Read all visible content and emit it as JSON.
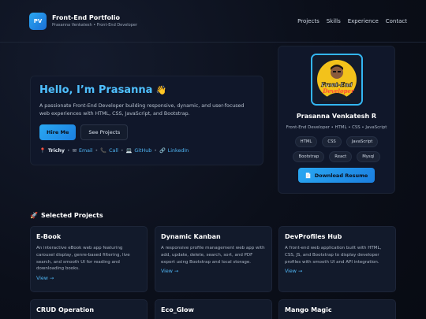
{
  "header": {
    "logo": "PV",
    "title": "Front-End Portfolio",
    "subtitle": "Prasanna Venkatesh • Front-End Developer",
    "nav": [
      "Projects",
      "Skills",
      "Experience",
      "Contact"
    ]
  },
  "hero": {
    "greeting": "Hello, I’m Prasanna",
    "wave": "👋",
    "description": "A passionate Front-End Developer building responsive, dynamic, and user-focused web experiences with HTML, CSS, JavaScript, and Bootstrap.",
    "hire_label": "Hire Me",
    "projects_label": "See Projects",
    "location": "Trichy",
    "email": "Email",
    "call": "Call",
    "github": "GitHub",
    "linkedin": "LinkedIn"
  },
  "profile": {
    "avatar_text_1": "Front-End",
    "avatar_text_2": "Developer",
    "name": "Prasanna Venkatesh R",
    "role": "Front-End Developer • HTML • CSS • JavaScript",
    "skills": [
      "HTML",
      "CSS",
      "JavaScript",
      "Bootstrap",
      "React",
      "Mysql"
    ],
    "resume_label": "Download Resume"
  },
  "projects": {
    "title": "Selected Projects",
    "view_label": "View →",
    "items": [
      {
        "title": "E-Book",
        "desc": "An interactive eBook web app featuring carousel display, genre-based filtering, live search, and smooth UI for reading and downloading books."
      },
      {
        "title": "Dynamic Kanban",
        "desc": "A responsive profile management web app with add, update, delete, search, sort, and PDF export using Bootstrap and local storage."
      },
      {
        "title": "DevProfiles Hub",
        "desc": "A front-end web application built with HTML, CSS, JS, and Bootstrap to display developer profiles with smooth UI and API integration."
      },
      {
        "title": "CRUD Operation"
      },
      {
        "title": "Eco_Glow"
      },
      {
        "title": "Mango Magic"
      }
    ]
  },
  "colors": {
    "accent": "#2aa8f2",
    "background": "#0b0f1a",
    "card": "#10172a"
  }
}
